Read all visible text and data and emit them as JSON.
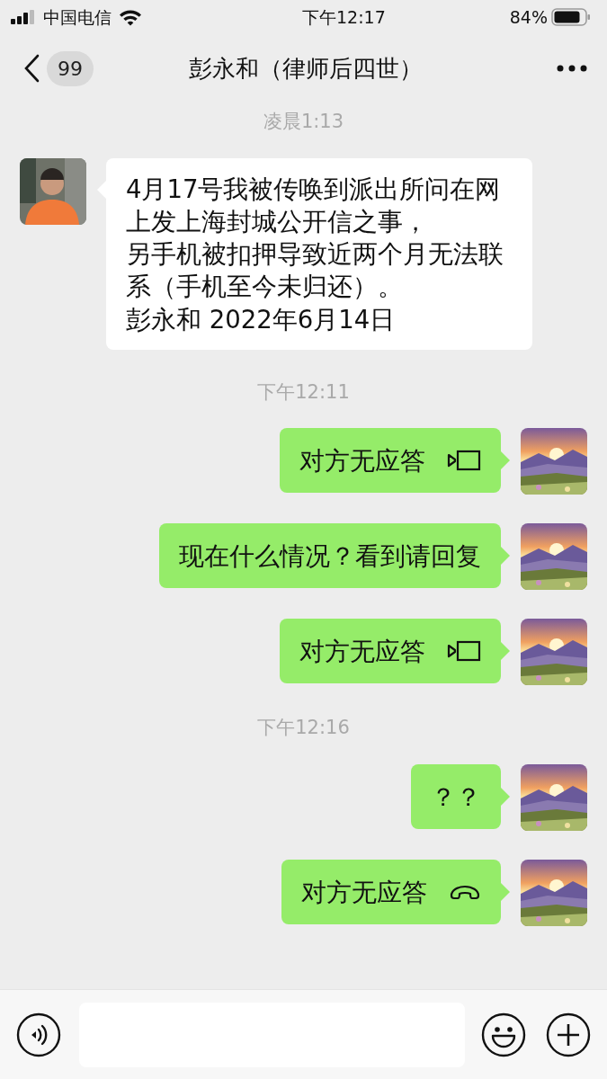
{
  "status_bar": {
    "carrier": "中国电信",
    "time": "下午12:17",
    "battery": "84%"
  },
  "header": {
    "unread": "99",
    "title": "彭永和（律师后四世）"
  },
  "messages": [
    {
      "kind": "time",
      "text": "凌晨1:13"
    },
    {
      "kind": "incoming",
      "paragraphs": [
        "4月17号我被传唤到派出所问在网上发上海封城公开信之事，",
        "另手机被扣押导致近两个月无法联系（手机至今未归还）。",
        "彭永和 2022年6月14日"
      ]
    },
    {
      "kind": "time",
      "text": "下午12:11"
    },
    {
      "kind": "videocall",
      "paragraphs": [
        "对方无应答"
      ]
    },
    {
      "kind": "outgoing",
      "paragraphs": [
        "现在什么情况？看到请回复"
      ]
    },
    {
      "kind": "videocall",
      "paragraphs": [
        "对方无应答"
      ]
    },
    {
      "kind": "time",
      "text": "下午12:16"
    },
    {
      "kind": "outgoing",
      "paragraphs": [
        "？？"
      ]
    },
    {
      "kind": "voicecall",
      "paragraphs": [
        "对方无应答"
      ]
    }
  ]
}
